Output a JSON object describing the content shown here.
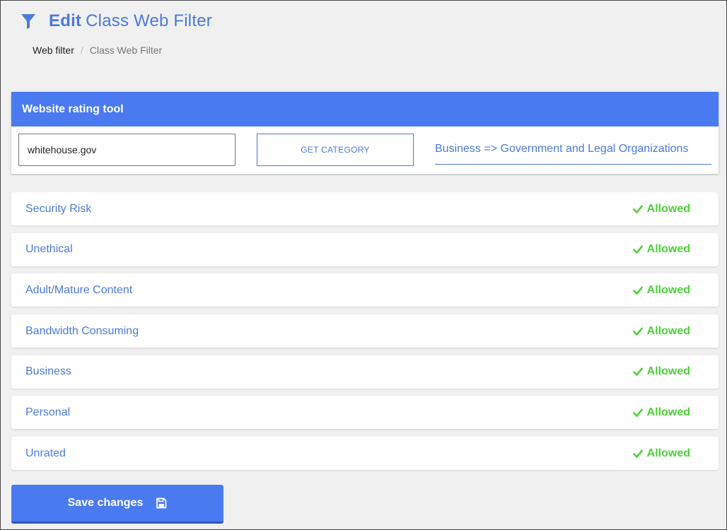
{
  "page": {
    "title_bold": "Edit",
    "title_rest": "Class Web Filter"
  },
  "breadcrumb": {
    "link": "Web filter",
    "separator": "/",
    "current": "Class Web Filter"
  },
  "rating_tool": {
    "header": "Website rating tool",
    "input_value": "whitehouse.gov",
    "button_label": "GET CATEGORY",
    "result": "Business => Government and Legal Organizations"
  },
  "categories": [
    {
      "name": "Security Risk",
      "status": "Allowed"
    },
    {
      "name": "Unethical",
      "status": "Allowed"
    },
    {
      "name": "Adult/Mature Content",
      "status": "Allowed"
    },
    {
      "name": "Bandwidth Consuming",
      "status": "Allowed"
    },
    {
      "name": "Business",
      "status": "Allowed"
    },
    {
      "name": "Personal",
      "status": "Allowed"
    },
    {
      "name": "Unrated",
      "status": "Allowed"
    }
  ],
  "save_button": {
    "label": "Save changes",
    "icon": "floppy-disk-icon"
  },
  "icons": {
    "title": "filter-icon",
    "status": "check-icon"
  },
  "colors": {
    "accent": "#4a7af0",
    "link_text": "#4a7ad9",
    "allowed": "#4cd137",
    "background": "#f0f0f0"
  }
}
